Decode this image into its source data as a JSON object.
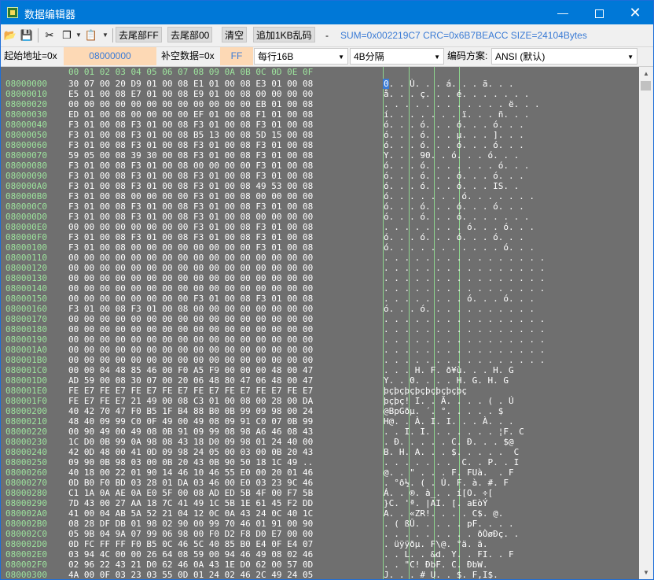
{
  "window": {
    "title": "数据编辑器",
    "minimize": "—",
    "close": "✕"
  },
  "toolbar": {
    "buttons": [
      "去尾部FF",
      "去尾部00",
      "清空",
      "追加1KB乱码"
    ],
    "dash": "-",
    "info": "SUM=0x002219C7 CRC=0x6B7BEACC SIZE=24104Bytes"
  },
  "options": {
    "start_label": "起始地址=0x",
    "start_value": "08000000",
    "fill_label": "补空数据=0x",
    "fill_value": "FF",
    "per_row": "每行16B",
    "group": "4B分隔",
    "encoding_label": "编码方案:",
    "encoding_value": "ANSI (默认)"
  },
  "hex": {
    "header": "00 01 02 03 04 05 06 07 08 09 0A 0B 0C 0D 0E 0F",
    "rows": [
      {
        "addr": "08000000",
        "hex": "30 07 00 20 D9 01 00 08 E1 01 00 08 E3 01 00 08",
        "ascii": "0. . Ù. . . á. . . ã. . ."
      },
      {
        "addr": "08000010",
        "hex": "E5 01 00 08 E7 01 00 08 E9 01 00 08 00 00 00 00",
        "ascii": "å. . . ç. . . é. . . . . . ."
      },
      {
        "addr": "08000020",
        "hex": "00 00 00 00 00 00 00 00 00 00 00 00 EB 01 00 08",
        "ascii": ". . . . . . . . . . . . ë. . ."
      },
      {
        "addr": "08000030",
        "hex": "ED 01 00 08 00 00 00 00 EF 01 00 08 F1 01 00 08",
        "ascii": "í. . . . . . . ï. . . ñ. . ."
      },
      {
        "addr": "08000040",
        "hex": "F3 01 00 08 F3 01 00 08 F3 01 00 08 F3 01 00 08",
        "ascii": "ó. . . ó. . . ó. . . ó. . ."
      },
      {
        "addr": "08000050",
        "hex": "F3 01 00 08 F3 01 00 08 B5 13 00 08 5D 15 00 08",
        "ascii": "ó. . . ó. . . µ. . . ]. . ."
      },
      {
        "addr": "08000060",
        "hex": "F3 01 00 08 F3 01 00 08 F3 01 00 08 F3 01 00 08",
        "ascii": "ó. . . ó. . . ó. . . ó. . ."
      },
      {
        "addr": "08000070",
        "hex": "59 05 00 08 39 30 00 08 F3 01 00 08 F3 01 00 08",
        "ascii": "Y. . . 90. . ó. . . ó. . ."
      },
      {
        "addr": "08000080",
        "hex": "F3 01 00 08 F3 01 00 08 00 00 00 00 F3 01 00 08",
        "ascii": "ó. . . ó. . . . . . . ó. . ."
      },
      {
        "addr": "08000090",
        "hex": "F3 01 00 08 F3 01 00 08 F3 01 00 08 F3 01 00 08",
        "ascii": "ó. . . ó. . . ó. . . ó. . ."
      },
      {
        "addr": "080000A0",
        "hex": "F3 01 00 08 F3 01 00 08 F3 01 00 08 49 53 00 08",
        "ascii": "ó. . . ó. . . ó. . . IS. ."
      },
      {
        "addr": "080000B0",
        "hex": "F3 01 00 08 00 00 00 00 F3 01 00 08 00 00 00 00",
        "ascii": "ó. . . . . . . ó. . . . . . ."
      },
      {
        "addr": "080000C0",
        "hex": "F3 01 00 08 F3 01 00 08 F3 01 00 08 F3 01 00 08",
        "ascii": "ó. . . ó. . . ó. . . ó. . ."
      },
      {
        "addr": "080000D0",
        "hex": "F3 01 00 08 F3 01 00 08 F3 01 00 08 00 00 00 00",
        "ascii": "ó. . . ó. . . ó. . . . . . ."
      },
      {
        "addr": "080000E0",
        "hex": "00 00 00 00 00 00 00 00 F3 01 00 08 F3 01 00 08",
        "ascii": ". . . . . . . . ó. . . ó. . ."
      },
      {
        "addr": "080000F0",
        "hex": "F3 01 00 08 F3 01 00 08 F3 01 00 08 F3 01 00 08",
        "ascii": "ó. . . ó. . . ó. . . ó. . ."
      },
      {
        "addr": "08000100",
        "hex": "F3 01 00 08 00 00 00 00 00 00 00 00 F3 01 00 08",
        "ascii": "ó. . . . . . . . . . . ó. . ."
      },
      {
        "addr": "08000110",
        "hex": "00 00 00 00 00 00 00 00 00 00 00 00 00 00 00 00",
        "ascii": ". . . . . . . . . . . . . . . ."
      },
      {
        "addr": "08000120",
        "hex": "00 00 00 00 00 00 00 00 00 00 00 00 00 00 00 00",
        "ascii": ". . . . . . . . . . . . . . . ."
      },
      {
        "addr": "08000130",
        "hex": "00 00 00 00 00 00 00 00 00 00 00 00 00 00 00 00",
        "ascii": ". . . . . . . . . . . . . . . ."
      },
      {
        "addr": "08000140",
        "hex": "00 00 00 00 00 00 00 00 00 00 00 00 00 00 00 00",
        "ascii": ". . . . . . . . . . . . . . . ."
      },
      {
        "addr": "08000150",
        "hex": "00 00 00 00 00 00 00 00 F3 01 00 08 F3 01 00 08",
        "ascii": ". . . . . . . . ó. . . ó. . ."
      },
      {
        "addr": "08000160",
        "hex": "F3 01 00 08 F3 01 00 08 00 00 00 00 00 00 00 00",
        "ascii": "ó. . . ó. . . . . . . . . . ."
      },
      {
        "addr": "08000170",
        "hex": "00 00 00 00 00 00 00 00 00 00 00 00 00 00 00 00",
        "ascii": ". . . . . . . . . . . . . . . ."
      },
      {
        "addr": "08000180",
        "hex": "00 00 00 00 00 00 00 00 00 00 00 00 00 00 00 00",
        "ascii": ". . . . . . . . . . . . . . . ."
      },
      {
        "addr": "08000190",
        "hex": "00 00 00 00 00 00 00 00 00 00 00 00 00 00 00 00",
        "ascii": ". . . . . . . . . . . . . . . ."
      },
      {
        "addr": "080001A0",
        "hex": "00 00 00 00 00 00 00 00 00 00 00 00 00 00 00 00",
        "ascii": ". . . . . . . . . . . . . . . ."
      },
      {
        "addr": "080001B0",
        "hex": "00 00 00 00 00 00 00 00 00 00 00 00 00 00 00 00",
        "ascii": ". . . . . . . . . . . . . . . ."
      },
      {
        "addr": "080001C0",
        "hex": "00 00 04 48 85 46 00 F0 A5 F9 00 00 00 48 00 47",
        "ascii": ". . . H. F. ð¥ù. . . H. G"
      },
      {
        "addr": "080001D0",
        "hex": "AD 59 00 08 30 07 00 20 06 48 80 47 06 48 00 47",
        "ascii": "­Y. . 0. . . . H. G. H. G"
      },
      {
        "addr": "080001E0",
        "hex": "FE E7 FE E7 FE E7 FE E7 FE E7 FE E7 FE E7 FE E7",
        "ascii": "þçþçþçþçþçþçþçþç"
      },
      {
        "addr": "080001F0",
        "hex": "FE E7 FE E7 21 49 00 08 C3 01 00 08 00 28 00 DA",
        "ascii": "þçþç! I. . Ã. . . . ( . Ú"
      },
      {
        "addr": "08000200",
        "hex": "40 42 70 47 F0 B5 1F B4 88 B0 0B 99 09 98 00 24",
        "ascii": "@BpGðµ. ´. °. . . . . $"
      },
      {
        "addr": "08000210",
        "hex": "48 40 09 99 C0 0F 49 00 49 08 09 91 C0 07 0B 99",
        "ascii": "H@. . À. I. I. . . À. . ."
      },
      {
        "addr": "08000220",
        "hex": "00 90 49 00 49 08 0B 91 09 99 08 98 A6 46 08 43",
        "ascii": ". . I. I. . . . . . . ¦F. C"
      },
      {
        "addr": "08000230",
        "hex": "1C D0 0B 99 0A 98 08 43 18 D0 09 98 01 24 40 00",
        "ascii": ". Ð. . . . . C. Ð. . . $@"
      },
      {
        "addr": "08000240",
        "hex": "42 0D 48 00 41 0D 09 98 24 05 00 03 00 0B 20 43",
        "ascii": "B. H. A. . . $. . . . .  C"
      },
      {
        "addr": "08000250",
        "hex": "09 90 0B 98 03 00 0B 20 43 0B 90 50 18 1C 49 ..",
        "ascii": ". . . . . . .  C. . P. . I"
      },
      {
        "addr": "08000260",
        "hex": "40 18 00 22 01 90 14 46 10 46 55 E0 00 20 01 46",
        "ascii": "@. . \" . . . F. FUà.  . F"
      },
      {
        "addr": "08000270",
        "hex": "0D B0 F0 BD 03 28 01 DA 03 46 00 E0 03 23 9C 46",
        "ascii": ". °ð½. ( . Ú. F. à. #. F"
      },
      {
        "addr": "08000280",
        "hex": "C1 1A 0A AE 0A E0 5F 00 08 AD ED 5B 4F 00 F7 5B",
        "ascii": "Á. . ®. à_. . ­í[O. ÷["
      },
      {
        "addr": "08000290",
        "hex": "7D 43 00 27 AA 18 7C 41 49 1C 5B 1E 61 45 F2 DD",
        "ascii": "}C. 'ª. |AI. [. aEòÝ"
      },
      {
        "addr": "080002A0",
        "hex": "41 00 04 AB 5A 52 21 04 12 0C 0A 43 24 0C 40 1C",
        "ascii": "A. . «ZR!. . . . C$. @."
      },
      {
        "addr": "080002B0",
        "hex": "08 28 DF DB 01 98 02 90 00 99 70 46 01 91 00 90",
        "ascii": ". ( ßÛ. . . . . pF. . . ."
      },
      {
        "addr": "080002C0",
        "hex": "05 9B 04 9A 07 99 06 98 00 F0 D2 F8 D0 E7 00 00",
        "ascii": ". . . . . . . . . ðÒøÐç. ."
      },
      {
        "addr": "080002D0",
        "hex": "0D FC FF FF F0 B5 0C 46 5C 40 85 B0 E4 0F E4 07",
        "ascii": ". üÿÿðµ. F\\@. °ä. ä."
      },
      {
        "addr": "080002E0",
        "hex": "03 94 4C 00 00 26 64 08 59 00 94 46 49 08 02 46",
        "ascii": ". . L. . &d. Y. . FI. . F"
      },
      {
        "addr": "080002F0",
        "hex": "02 96 22 43 21 D0 62 46 0A 43 1E D0 62 00 57 0D",
        "ascii": ". . \"C! ÐbF. C. ÐbW."
      },
      {
        "addr": "08000300",
        "hex": "4A 00 0F 03 23 03 55 0D 01 24 02 46 2C 49 24 05",
        "ascii": "J. . . # U. . $. F,I$."
      }
    ]
  }
}
